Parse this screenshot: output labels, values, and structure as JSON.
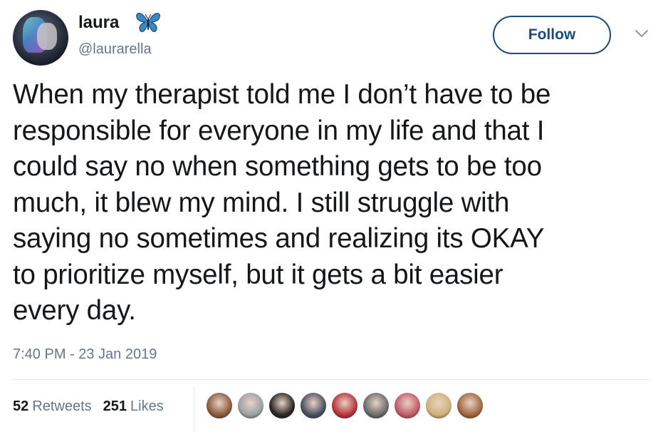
{
  "tweet": {
    "author_name": "laura",
    "author_handle": "@laurarella",
    "follow_label": "Follow",
    "text": "When my therapist told me I don’t have to be\nresponsible for everyone in my life and that I\ncould say no when something gets to be too\nmuch, it blew my mind. I still struggle with\nsaying no sometimes and realizing its OKAY\nto prioritize myself, but it gets a bit easier\nevery day.",
    "timestamp": "7:40 PM - 23 Jan 2019",
    "retweets_count": "52",
    "retweets_label": "Retweets",
    "likes_count": "251",
    "likes_label": "Likes"
  },
  "icons": {
    "name_emoji": "butterfly-icon",
    "menu": "chevron-down-icon"
  },
  "colors": {
    "follow_border": "#1c4a7a",
    "secondary_text": "#657786",
    "butterfly": "#3b88c3"
  },
  "likers": [
    {
      "name": "liker-avatar-1",
      "color": "#8a5a3c"
    },
    {
      "name": "liker-avatar-2",
      "color": "#9aa0a8"
    },
    {
      "name": "liker-avatar-3",
      "color": "#2b2522"
    },
    {
      "name": "liker-avatar-4",
      "color": "#4a5060"
    },
    {
      "name": "liker-avatar-5",
      "color": "#b8323a"
    },
    {
      "name": "liker-avatar-6",
      "color": "#6b6b6b"
    },
    {
      "name": "liker-avatar-7",
      "color": "#c25a6a"
    },
    {
      "name": "liker-avatar-8",
      "color": "#d2b27a"
    },
    {
      "name": "liker-avatar-9",
      "color": "#a0663e"
    }
  ]
}
